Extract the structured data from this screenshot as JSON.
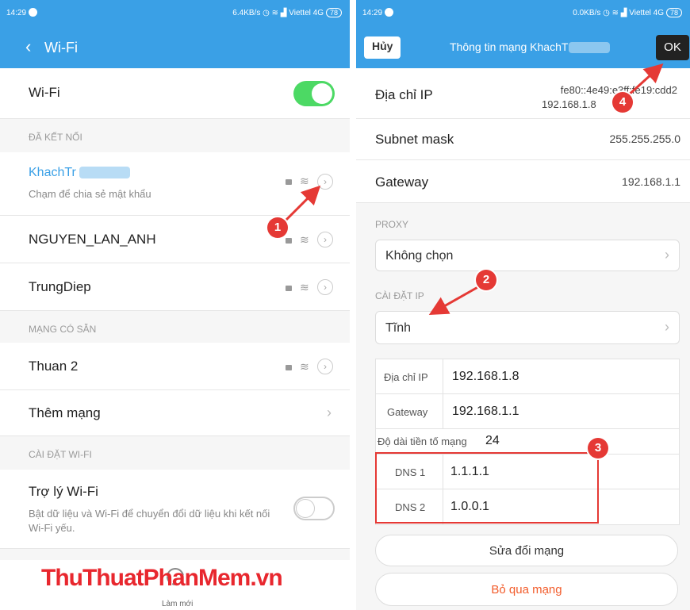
{
  "left": {
    "status": {
      "time": "14:29",
      "right": "6.4KB/s",
      "carrier": "Viettel 4G",
      "battery": "78"
    },
    "title": "Wi-Fi",
    "wifi_toggle_label": "Wi-Fi",
    "connected_header": "ĐÃ KẾT NỐI",
    "connected_name": "KhachTr",
    "connected_sub": "Chạm để chia sẻ mật khẩu",
    "networks": [
      "NGUYEN_LAN_ANH",
      "TrungDiep"
    ],
    "available_header": "MẠNG CÓ SẴN",
    "available": [
      "Thuan 2"
    ],
    "add_network": "Thêm mạng",
    "settings_header": "CÀI ĐẶT WI-FI",
    "assistant_title": "Trợ lý Wi-Fi",
    "assistant_desc": "Bật dữ liệu và Wi-Fi để chuyển đổi dữ liệu khi kết nối Wi-Fi yếu.",
    "refresh": "Làm mới",
    "watermark": "ThuThuatPhanMem.vn"
  },
  "right": {
    "status": {
      "time": "14:29",
      "right": "0.0KB/s",
      "carrier": "Viettel 4G",
      "battery": "78"
    },
    "cancel": "Hủy",
    "title": "Thông tin mạng KhachT",
    "ok": "OK",
    "ip_label": "Địa chỉ IP",
    "ip_value1": "fe80::4e49:e3ff:fe19:cdd2",
    "ip_value2": "192.168.1.8",
    "subnet_label": "Subnet mask",
    "subnet_value": "255.255.255.0",
    "gateway_label": "Gateway",
    "gateway_value": "192.168.1.1",
    "proxy_header": "PROXY",
    "proxy_value": "Không chọn",
    "ip_settings_header": "CÀI ĐẶT IP",
    "ip_settings_value": "Tĩnh",
    "f_ip_label": "Địa chỉ IP",
    "f_ip_value": "192.168.1.8",
    "f_gw_label": "Gateway",
    "f_gw_value": "192.168.1.1",
    "prefix_label": "Độ dài tiền tố mạng",
    "prefix_value": "24",
    "dns1_label": "DNS 1",
    "dns1_value": "1.1.1.1",
    "dns2_label": "DNS 2",
    "dns2_value": "1.0.0.1",
    "modify": "Sửa đổi mạng",
    "forget": "Bỏ qua mạng"
  },
  "annotations": [
    "1",
    "2",
    "3",
    "4"
  ],
  "colors": {
    "accent": "#3aa0e6",
    "toggle": "#4cd964",
    "annotation": "#e53935",
    "danger": "#f25c2b"
  }
}
